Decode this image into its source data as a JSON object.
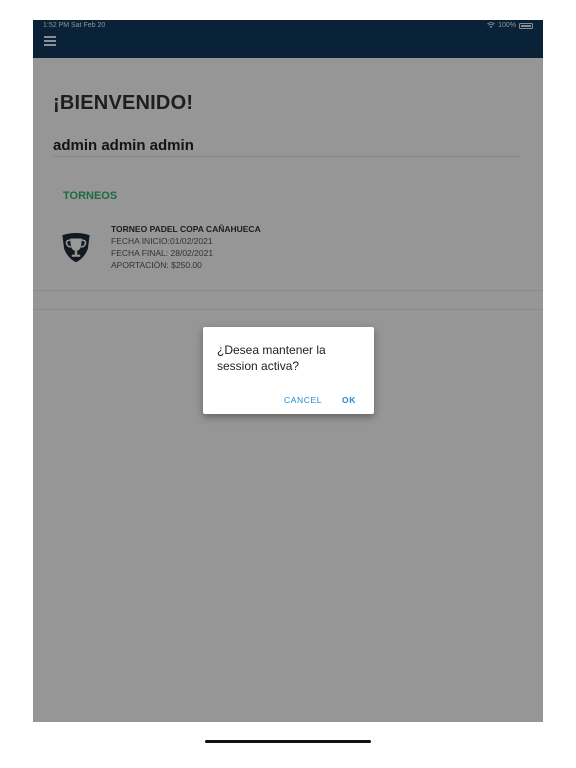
{
  "status_bar": {
    "time": "1:52 PM  Sat Feb 20",
    "battery": "100%"
  },
  "header": {
    "menu_icon": "hamburger-menu-icon",
    "color": "#123a5c"
  },
  "main": {
    "welcome": "¡BIENVENIDO!",
    "username": "admin admin admin",
    "section_title": "TORNEOS",
    "section_color": "#2fb36b",
    "tournaments": [
      {
        "icon": "trophy-icon",
        "name": "TORNEO PADEL COPA CAÑAHUECA",
        "start": "FECHA INICIO:01/02/2021",
        "end": "FECHA FINAL: 28/02/2021",
        "contribution": "APORTACIÓN: $250.00"
      }
    ]
  },
  "dialog": {
    "message": "¿Desea mantener la session activa?",
    "cancel_label": "CANCEL",
    "ok_label": "OK",
    "button_color": "#1f8ad6"
  }
}
